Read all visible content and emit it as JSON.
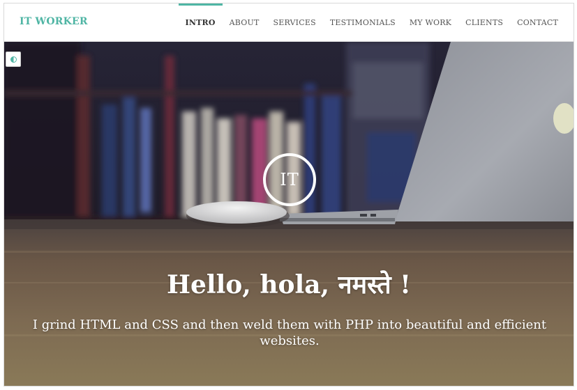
{
  "navbar": {
    "brand": "IT WORKER",
    "items": [
      {
        "label": "INTRO",
        "active": true
      },
      {
        "label": "ABOUT",
        "active": false
      },
      {
        "label": "SERVICES",
        "active": false
      },
      {
        "label": "TESTIMONIALS",
        "active": false
      },
      {
        "label": "MY WORK",
        "active": false
      },
      {
        "label": "CLIENTS",
        "active": false
      },
      {
        "label": "CONTACT",
        "active": false
      }
    ]
  },
  "hero": {
    "logo_text": "IT",
    "headline": "Hello, hola, नमस्ते !",
    "tagline": "I grind HTML and CSS and then weld them with PHP into beautiful and efficient websites."
  },
  "colors": {
    "accent": "#4fb5a4",
    "nav_text": "#555555",
    "hero_text": "#ffffff"
  },
  "icons": {
    "theme_toggle": "contrast-icon"
  }
}
